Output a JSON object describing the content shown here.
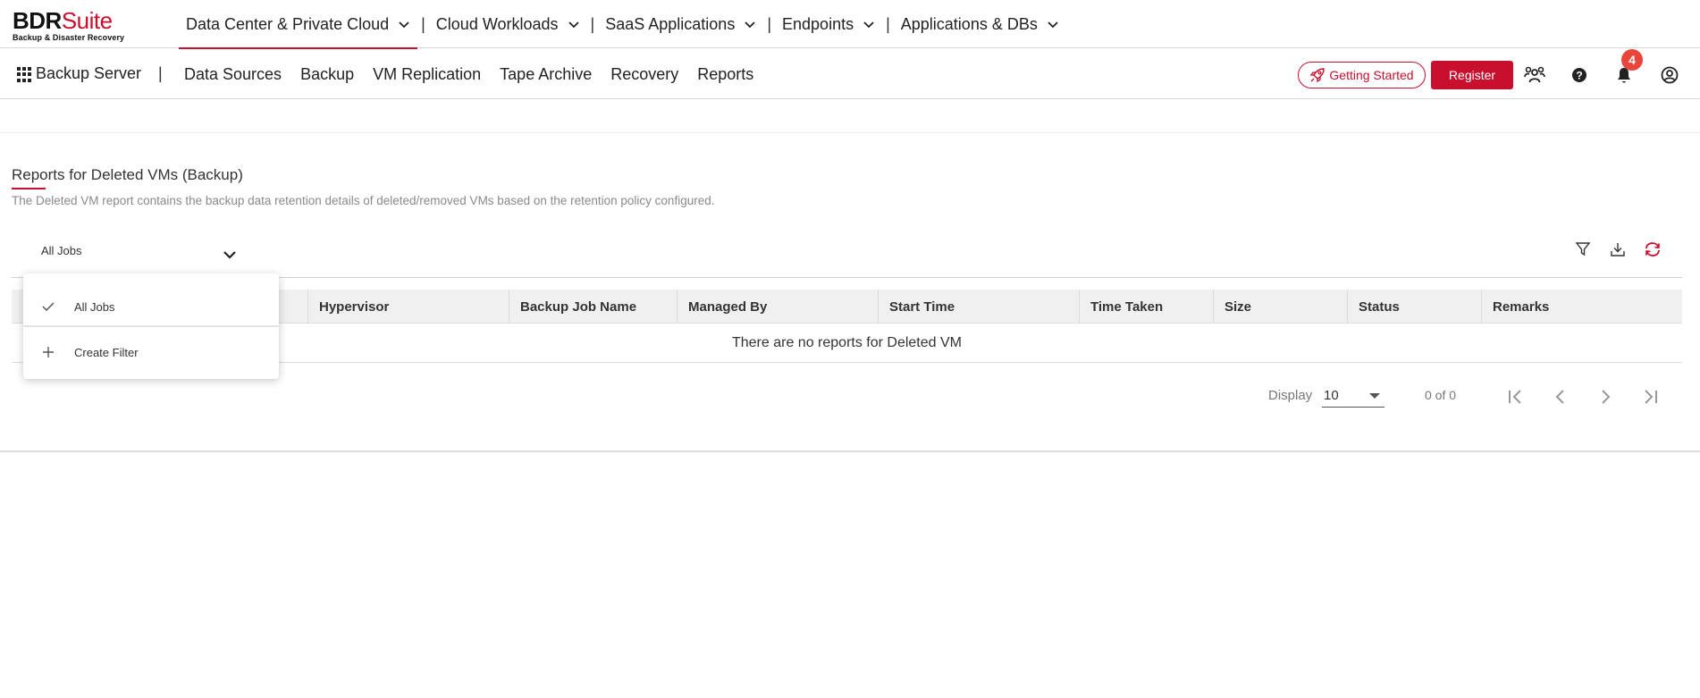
{
  "brand": {
    "name_bold": "BDR",
    "name_accent": "Suite",
    "tagline": "Backup & Disaster Recovery",
    "accent_color": "#c8102e"
  },
  "product_nav": [
    {
      "label": "Data Center & Private Cloud",
      "active": true
    },
    {
      "label": "Cloud Workloads",
      "active": false
    },
    {
      "label": "SaaS Applications",
      "active": false
    },
    {
      "label": "Endpoints",
      "active": false
    },
    {
      "label": "Applications & DBs",
      "active": false
    }
  ],
  "product_nav_separator": "|",
  "subbar": {
    "server_label": "Backup Server",
    "separator": "|",
    "nav": [
      "Data Sources",
      "Backup",
      "VM Replication",
      "Tape Archive",
      "Recovery",
      "Reports"
    ],
    "getting_started_label": "Getting Started",
    "register_label": "Register",
    "notification_count": "4",
    "icons": [
      "users-group-icon",
      "help-icon",
      "bell-icon",
      "account-icon"
    ]
  },
  "page": {
    "title": "Reports for Deleted VMs (Backup)",
    "description": "The Deleted VM report contains the backup data retention details of deleted/removed VMs based on the retention policy configured."
  },
  "filter": {
    "selected": "All Jobs",
    "options": [
      {
        "label": "All Jobs",
        "icon": "check-icon"
      },
      {
        "label": "Create Filter",
        "icon": "plus-icon"
      }
    ]
  },
  "toolbar_icons": [
    "filter-icon",
    "download-icon",
    "refresh-icon"
  ],
  "table": {
    "columns": [
      "Hypervisor",
      "Backup Job Name",
      "Managed By",
      "Start Time",
      "Time Taken",
      "Size",
      "Status",
      "Remarks"
    ],
    "empty_message": "There are no reports for Deleted VM"
  },
  "pagination": {
    "display_label": "Display",
    "page_size": "10",
    "count_text": "0 of 0"
  }
}
